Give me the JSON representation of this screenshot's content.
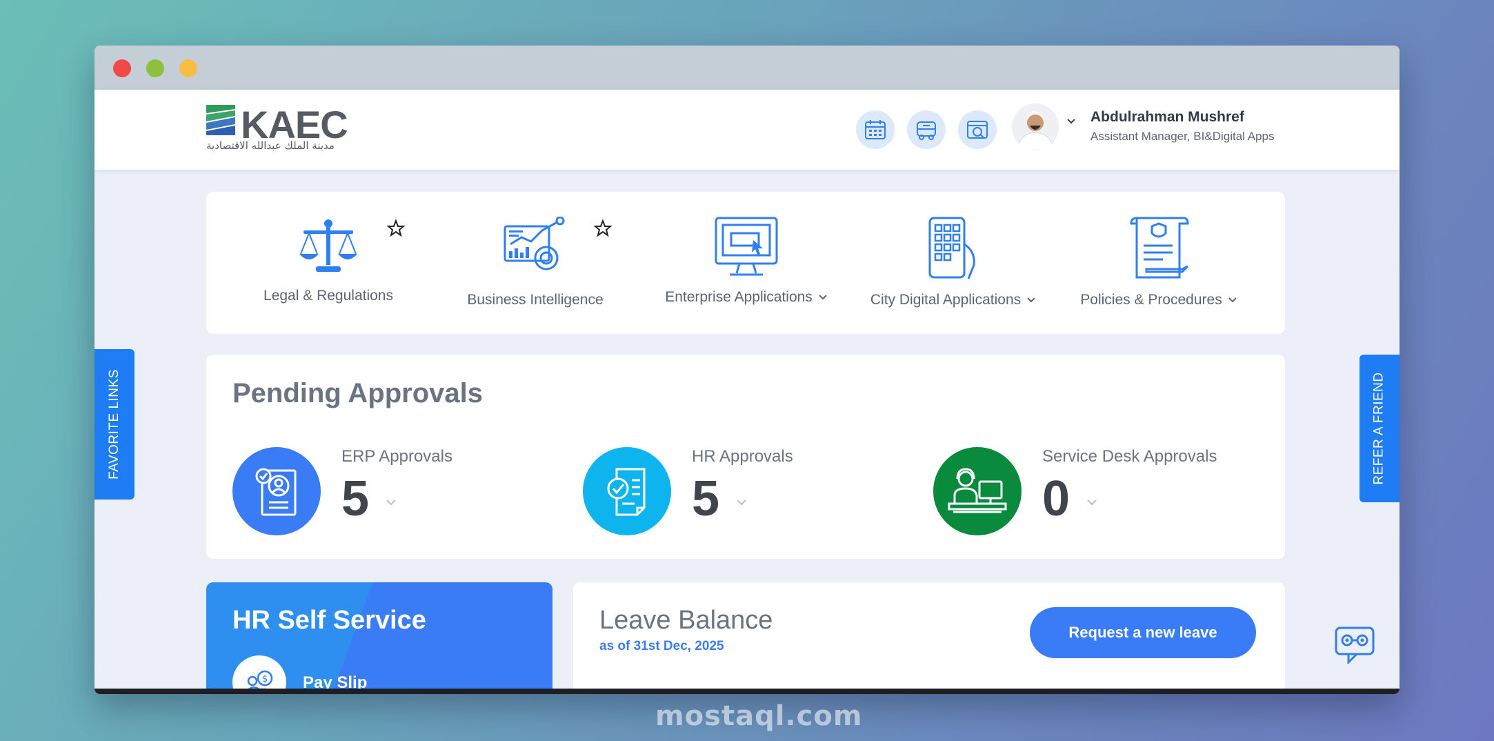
{
  "header": {
    "logo_text": "KAEC",
    "logo_subtitle": "مدينة الملك عبدالله الاقتصادية",
    "user_name": "Abdulrahman Mushref",
    "user_role": "Assistant Manager, BI&Digital Apps"
  },
  "apps": [
    {
      "label": "Legal & Regulations",
      "icon": "scales-icon",
      "favorite": true
    },
    {
      "label": "Business Intelligence",
      "icon": "analytics-icon",
      "favorite": true
    },
    {
      "label": "Enterprise Applications",
      "icon": "monitor-icon",
      "dropdown": true
    },
    {
      "label": "City Digital Applications",
      "icon": "phone-grid-icon",
      "dropdown": true
    },
    {
      "label": "Policies & Procedures",
      "icon": "document-scroll-icon",
      "dropdown": true
    }
  ],
  "pending": {
    "title": "Pending Approvals",
    "items": [
      {
        "label": "ERP Approvals",
        "count": "5",
        "color": "#3a7cf6"
      },
      {
        "label": "HR Approvals",
        "count": "5",
        "color": "#0db4ee"
      },
      {
        "label": "Service Desk Approvals",
        "count": "0",
        "color": "#0a8a3c"
      }
    ]
  },
  "hr_self_service": {
    "title": "HR Self Service",
    "first_item": "Pay Slip"
  },
  "leave_balance": {
    "title": "Leave Balance",
    "subtitle": "as of 31st Dec, 2025",
    "request_button": "Request a new leave"
  },
  "side_tabs": {
    "favorite": "FAVORITE LINKS",
    "refer": "REFER A FRIEND"
  },
  "watermark": {
    "text": "mostaql.com"
  },
  "colors": {
    "primary": "#3a7cf6",
    "hr_blue": "#0db4ee",
    "service_green": "#0a8a3c"
  }
}
